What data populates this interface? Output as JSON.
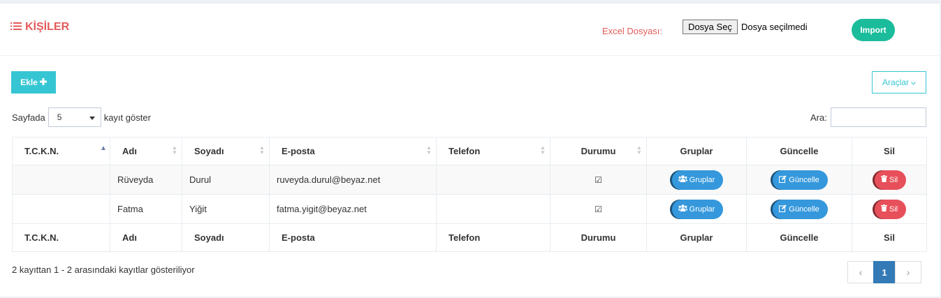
{
  "header": {
    "title": "KİŞİLER",
    "excel_label": "Excel Dosyası:",
    "file_button": "Dosya Seç",
    "file_status": "Dosya seçilmedi",
    "import_label": "Import"
  },
  "toolbar": {
    "add_label": "Ekle",
    "tools_label": "Araçlar"
  },
  "length_menu": {
    "prefix": "Sayfada",
    "value": "5",
    "suffix": "kayıt göster"
  },
  "search": {
    "label": "Ara:",
    "value": ""
  },
  "table": {
    "columns": [
      "T.C.K.N.",
      "Adı",
      "Soyadı",
      "E-posta",
      "Telefon",
      "Durumu",
      "Gruplar",
      "Güncelle",
      "Sil"
    ],
    "rows": [
      {
        "tckn": "",
        "adi": "Rüveyda",
        "soyadi": "Durul",
        "eposta": "ruveyda.durul@beyaz.net",
        "telefon": "",
        "durumu": "checked"
      },
      {
        "tckn": "",
        "adi": "Fatma",
        "soyadi": "Yiğit",
        "eposta": "fatma.yigit@beyaz.net",
        "telefon": "",
        "durumu": "checked"
      }
    ],
    "row_actions": {
      "groups_label": "Gruplar",
      "update_label": "Güncelle",
      "delete_label": "Sil"
    }
  },
  "footer": {
    "info": "2 kayıttan 1 - 2 arasındaki kayıtlar gösteriliyor",
    "pagination": {
      "prev": "‹",
      "current": "1",
      "next": "›"
    }
  },
  "colors": {
    "accent_red": "#e35b5a",
    "import_green": "#1bbc9b",
    "add_cyan": "#36c6d3",
    "action_blue": "#3598dc",
    "delete_red": "#e7505a",
    "page_active": "#337ab7"
  }
}
